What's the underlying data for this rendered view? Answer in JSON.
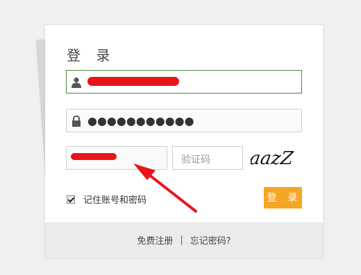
{
  "login": {
    "title": "登 录",
    "password_mask": "●●●●●●●●●●●",
    "captcha_placeholder": "验证码",
    "captcha_text": "aazZ",
    "remember_label": "记住账号和密码",
    "remember_checked": true,
    "login_button": "登 录"
  },
  "footer": {
    "register_link": "免费注册",
    "separator": "|",
    "forgot_link": "忘记密码?"
  },
  "colors": {
    "accent": "#f5a623",
    "active_border": "#4d8c3a",
    "annotation": "#e8141a"
  },
  "icons": {
    "user": "user-icon",
    "lock": "lock-icon"
  }
}
